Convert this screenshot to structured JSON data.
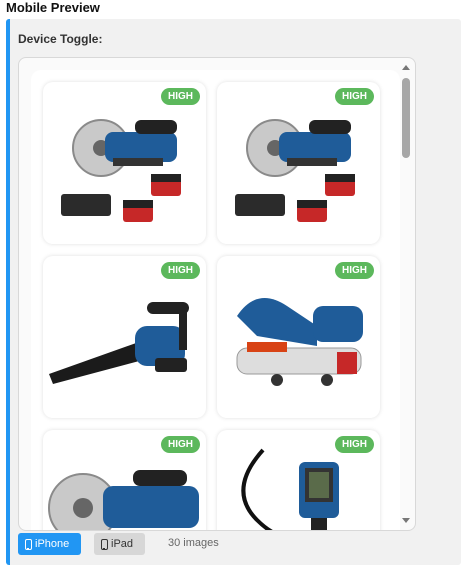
{
  "section_title": "Mobile Preview",
  "device_toggle_label": "Device Toggle:",
  "devices": [
    {
      "label": "iPhone",
      "icon": "phone-icon",
      "selected": true
    },
    {
      "label": "iPad",
      "icon": "tablet-icon",
      "selected": false
    }
  ],
  "image_count": "30 images",
  "colors": {
    "accent": "#2196f3",
    "badge": "#5cb85c",
    "tool_blue": "#1f5c99",
    "battery_red": "#c62828"
  },
  "cards": [
    {
      "badge": "HIGH",
      "product": "cordless-concrete-saw-kit-image"
    },
    {
      "badge": "HIGH",
      "product": "cordless-concrete-saw-kit-image"
    },
    {
      "badge": "HIGH",
      "product": "cordless-leaf-blower-image"
    },
    {
      "badge": "HIGH",
      "product": "cordless-band-saw-image"
    },
    {
      "badge": "HIGH",
      "product": "cordless-concrete-saw-image"
    },
    {
      "badge": "HIGH",
      "product": "inspection-camera-image"
    }
  ]
}
